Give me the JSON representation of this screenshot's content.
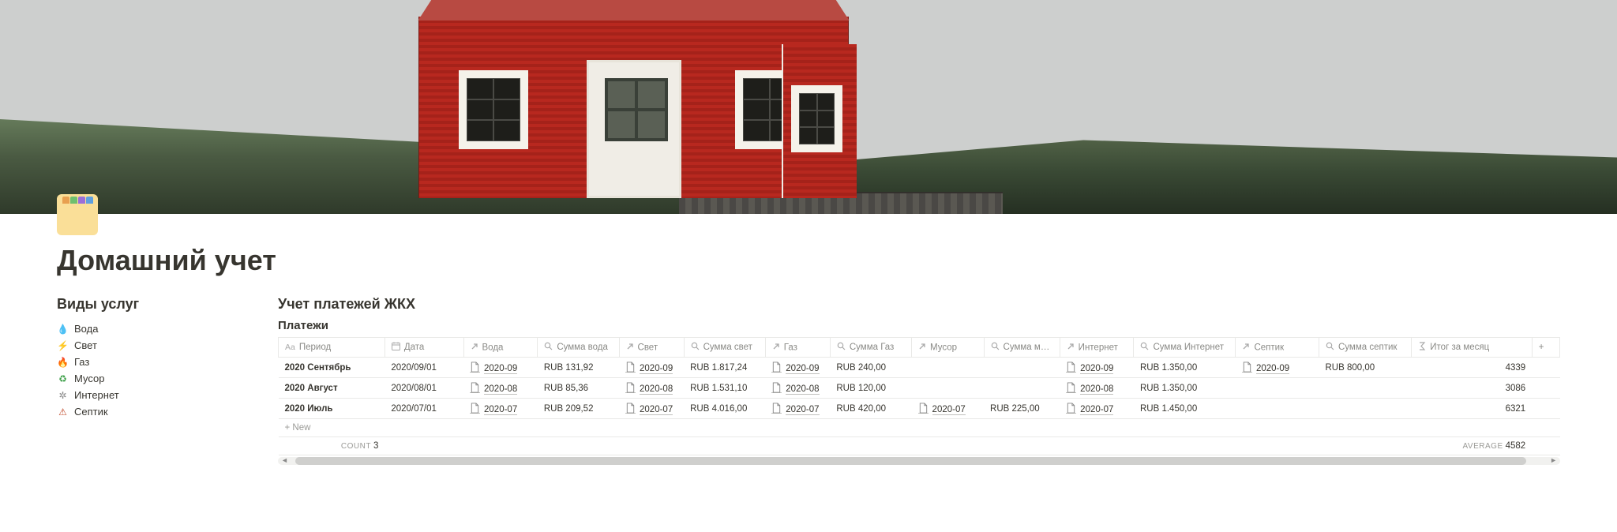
{
  "page": {
    "title": "Домашний учет"
  },
  "sidebar": {
    "heading": "Виды услуг",
    "services": [
      {
        "icon": "💧",
        "label": "Вода",
        "icon_color": "#4aa3e0"
      },
      {
        "icon": "⚡",
        "label": "Свет",
        "icon_color": "#f0a020"
      },
      {
        "icon": "🔥",
        "label": "Газ",
        "icon_color": "#4aa3e0"
      },
      {
        "icon": "♻",
        "label": "Мусор",
        "icon_color": "#3fa04a"
      },
      {
        "icon": "✲",
        "label": "Интернет",
        "icon_color": "#888"
      },
      {
        "icon": "⚠",
        "label": "Септик",
        "icon_color": "#c04a2a"
      }
    ]
  },
  "main": {
    "db_title": "Учет платежей ЖКХ",
    "view_name": "Платежи",
    "columns": [
      {
        "icon": "Aa",
        "label": "Период"
      },
      {
        "icon": "cal",
        "label": "Дата"
      },
      {
        "icon": "arrow",
        "label": "Вода"
      },
      {
        "icon": "search",
        "label": "Сумма вода"
      },
      {
        "icon": "arrow",
        "label": "Свет"
      },
      {
        "icon": "search",
        "label": "Сумма свет"
      },
      {
        "icon": "arrow",
        "label": "Газ"
      },
      {
        "icon": "search",
        "label": "Сумма Газ"
      },
      {
        "icon": "arrow",
        "label": "Мусор"
      },
      {
        "icon": "search",
        "label": "Сумма мус..."
      },
      {
        "icon": "arrow",
        "label": "Интернет"
      },
      {
        "icon": "search",
        "label": "Сумма Интернет"
      },
      {
        "icon": "arrow",
        "label": "Септик"
      },
      {
        "icon": "search",
        "label": "Сумма септик"
      },
      {
        "icon": "func",
        "label": "Итог за месяц"
      }
    ],
    "rows": [
      {
        "period": "2020 Сентябрь",
        "date": "2020/09/01",
        "voda": "2020-09",
        "sum_voda": "RUB 131,92",
        "svet": "2020-09",
        "sum_svet": "RUB 1.817,24",
        "gaz": "2020-09",
        "sum_gaz": "RUB 240,00",
        "musor": "",
        "sum_musor": "",
        "internet": "2020-09",
        "sum_internet": "RUB 1.350,00",
        "septik": "2020-09",
        "sum_septik": "RUB 800,00",
        "total": "4339"
      },
      {
        "period": "2020 Август",
        "date": "2020/08/01",
        "voda": "2020-08",
        "sum_voda": "RUB 85,36",
        "svet": "2020-08",
        "sum_svet": "RUB 1.531,10",
        "gaz": "2020-08",
        "sum_gaz": "RUB 120,00",
        "musor": "",
        "sum_musor": "",
        "internet": "2020-08",
        "sum_internet": "RUB 1.350,00",
        "septik": "",
        "sum_septik": "",
        "total": "3086"
      },
      {
        "period": "2020 Июль",
        "date": "2020/07/01",
        "voda": "2020-07",
        "sum_voda": "RUB 209,52",
        "svet": "2020-07",
        "sum_svet": "RUB 4.016,00",
        "gaz": "2020-07",
        "sum_gaz": "RUB 420,00",
        "musor": "2020-07",
        "sum_musor": "RUB 225,00",
        "internet": "2020-07",
        "sum_internet": "RUB 1.450,00",
        "septik": "",
        "sum_septik": "",
        "total": "6321"
      }
    ],
    "new_row": "+  New",
    "footer": {
      "count_label": "COUNT",
      "count_value": "3",
      "avg_label": "AVERAGE",
      "avg_value": "4582"
    },
    "add_col": "+"
  }
}
